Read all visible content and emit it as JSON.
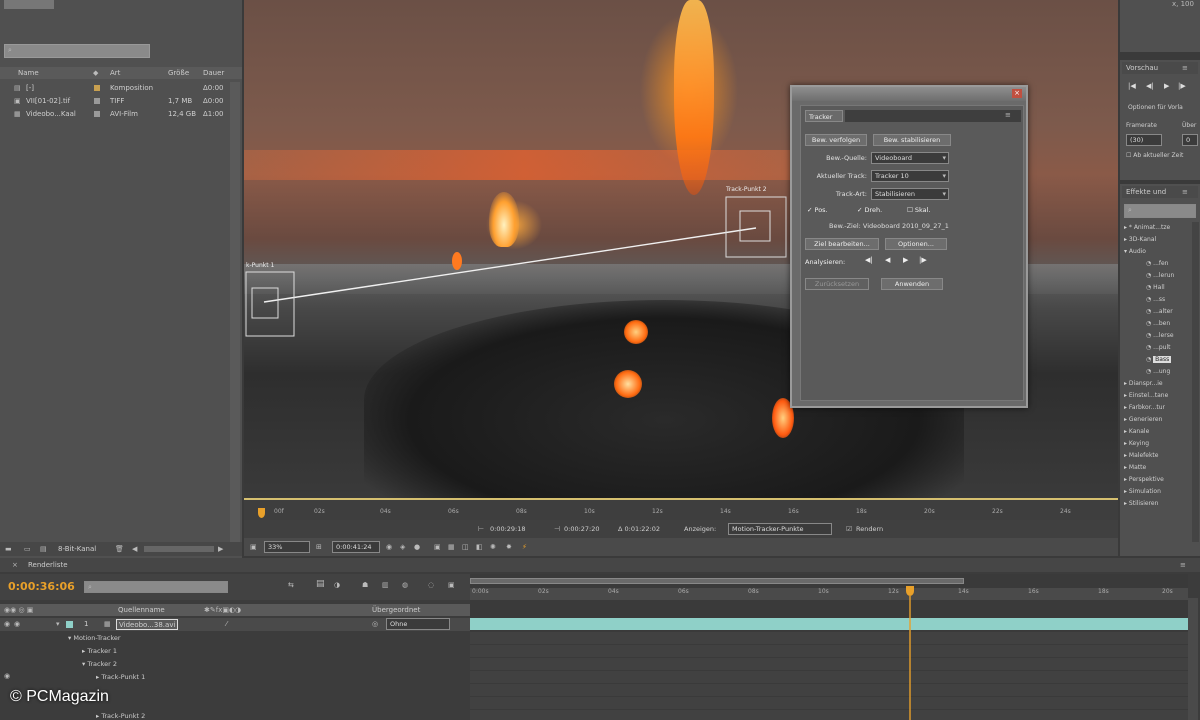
{
  "project": {
    "search_placeholder": "",
    "columns": [
      "Name",
      "Art",
      "Größe",
      "Dauer"
    ],
    "items": [
      {
        "name": "[-]",
        "type": "Komposition",
        "size": "",
        "dur": "Δ0:00"
      },
      {
        "name": "VII[01-02].tif",
        "type": "TIFF",
        "size": "1,7 MB",
        "dur": "Δ0:00"
      },
      {
        "name": "Videobo...Kaal",
        "type": "AVI-Film",
        "size": "12,4 GB",
        "dur": "Δ1:00"
      }
    ],
    "footer_label": "8-Bit-Kanal"
  },
  "viewer": {
    "track_label_right": "Track-Punkt 2",
    "track_label_left": "k-Punkt 1",
    "ruler_ticks": [
      "00f",
      "02s",
      "04s",
      "06s",
      "08s",
      "10s",
      "12s",
      "14s",
      "16s",
      "18s",
      "20s",
      "22s",
      "24s",
      "26s"
    ],
    "status": {
      "time_start": "0:00:29:18",
      "time_end": "0:00:27:20",
      "delta": "Δ 0:01:22:02",
      "view_label": "Anzeigen:",
      "view_value": "Motion-Tracker-Punkte",
      "render_label": "Rendern"
    },
    "bottom": {
      "zoom": "33%",
      "timecode": "0:00:41:24"
    }
  },
  "tracker": {
    "tab": "Tracker",
    "btn_follow": "Bew. verfolgen",
    "btn_stabilize": "Bew. stabilisieren",
    "source_label": "Bew.-Quelle:",
    "source_value": "Videoboard",
    "current_label": "Aktueller Track:",
    "current_value": "Tracker 10",
    "type_label": "Track-Art:",
    "type_value": "Stabilisieren",
    "pos_label": "Pos.",
    "rot_label": "Dreh.",
    "scale_label": "Skal.",
    "target_text": "Bew.-Ziel: Videoboard 2010_09_27_1",
    "btn_edit_target": "Ziel bearbeiten...",
    "btn_options": "Optionen...",
    "analyze_label": "Analysieren:",
    "btn_reset": "Zurücksetzen",
    "btn_apply": "Anwenden"
  },
  "preview": {
    "title": "Vorschau",
    "options_label": "Optionen für Vorla",
    "framerate_label": "Framerate",
    "skip_label": "Über",
    "fps_value": "(30)",
    "skip_value": "0",
    "from_current_label": "Ab aktueller Zeit"
  },
  "effects": {
    "title": "Effekte und",
    "search_placeholder": "",
    "items": [
      "* Animat...tze",
      "3D-Kanal",
      "Audio",
      "...fen",
      "...lerun",
      "Hall",
      "...ss",
      "...alter",
      "...ben",
      "...lerse",
      "...pult",
      "Bass",
      "...ung",
      "Dianspr...ie",
      "Einstel...tane",
      "Farbkor...tur",
      "Generieren",
      "Kanale",
      "Keying",
      "Malefekte",
      "Matte",
      "Perspektive",
      "Simulation",
      "Stilisieren"
    ]
  },
  "timeline": {
    "tab": "Renderliste",
    "timecode": "0:00:36:06",
    "columns_label": "Quellenname",
    "parent_label": "Übergeordnet",
    "layer_name": "Videobo...38.avi",
    "layer_num": "1",
    "parent_value": "Ohne",
    "tree": [
      "Motion-Tracker",
      "Tracker 1",
      "Tracker 2",
      "Track-Punkt 1",
      "Track-Punkt 2"
    ],
    "ruler_ticks": [
      "0:00s",
      "02s",
      "04s",
      "06s",
      "08s",
      "10s",
      "12s",
      "14s",
      "16s",
      "18s",
      "20s",
      "22s",
      "24s"
    ]
  },
  "watermark": "© PCMagazin",
  "colors": {
    "timecode": "#e8a02a",
    "playhead": "#e8a02a",
    "layer_bar": "#8fd0c8"
  }
}
